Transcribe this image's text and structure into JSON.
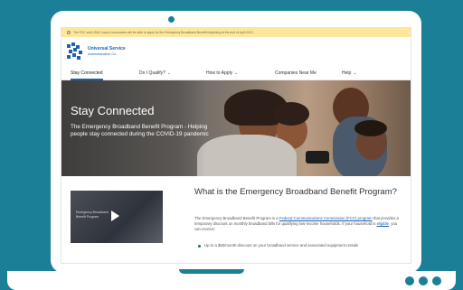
{
  "banner": {
    "text": "The FCC and USAC expect consumers will be able to apply for the Emergency Broadband Benefit beginning at the end of April 2021."
  },
  "logo": {
    "title": "Universal Service",
    "subtitle": "Administrative Co."
  },
  "nav": {
    "items": [
      {
        "label": "Stay Connected",
        "has_dropdown": false,
        "active": true
      },
      {
        "label": "Do I Qualify?",
        "has_dropdown": true,
        "active": false
      },
      {
        "label": "How to Apply",
        "has_dropdown": true,
        "active": false
      },
      {
        "label": "Companies Near Me",
        "has_dropdown": false,
        "active": false
      },
      {
        "label": "Help",
        "has_dropdown": true,
        "active": false
      }
    ]
  },
  "hero": {
    "title": "Stay Connected",
    "subtitle": "The Emergency Broadband Benefit Program - Helping people stay connected during the COVID-19 pandemic"
  },
  "video": {
    "caption": "Emergency Broadband Benefit Program"
  },
  "section": {
    "title": "What is the Emergency Broadband Benefit Program?",
    "body_pre": "The Emergency Broadband Benefit Program is a ",
    "body_link1": "Federal Communications Commission (FCC) program",
    "body_mid": " that provides a temporary discount on monthly broadband bills for qualifying low-income households. If your household is ",
    "body_link2": "eligible",
    "body_post": ", you can receive:",
    "bullets": [
      "Up to a $50/month discount on your broadband service and associated equipment rentals"
    ]
  },
  "colors": {
    "frame": "#1b7f98",
    "banner": "#ffe79a",
    "brand_blue": "#1e61b3"
  }
}
